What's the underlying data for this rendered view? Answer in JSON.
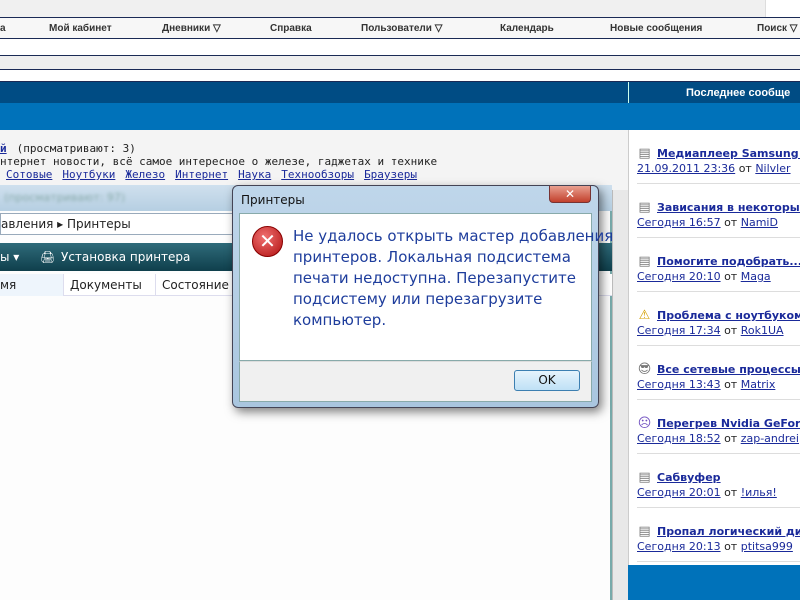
{
  "nav": {
    "items": [
      "а",
      "Мой кабинет",
      "Дневники ▽",
      "Справка",
      "Пользователи ▽",
      "Календарь",
      "Новые сообщения",
      "Поиск ▽"
    ]
  },
  "header": {
    "last_post_label": "Последнее сообще"
  },
  "forum": {
    "title_link": "й",
    "viewers": "(просматривают: 3)",
    "description": "нтернет новости, всё самое интересное о железе, гаджетах и технике",
    "sublinks": [
      "Сотовые",
      "Ноутбуки",
      "Железо",
      "Интернет",
      "Наука",
      "Технообзоры",
      "Браузеры"
    ]
  },
  "last_posts": [
    {
      "icon": "document-icon",
      "glyph": "▤",
      "title": "Медиаплеер Samsung YP",
      "date": "21.09.2011 23:36",
      "from": "от",
      "user": "Nilvler"
    },
    {
      "icon": "document-icon",
      "glyph": "▤",
      "title": "Зависания в некоторых и",
      "date": "Сегодня 16:57",
      "from": "от",
      "user": "NamiD"
    },
    {
      "icon": "document-icon",
      "glyph": "▤",
      "title": "Помогите подобрать...",
      "date": "Сегодня 20:10",
      "from": "от",
      "user": "Maga"
    },
    {
      "icon": "warning-icon",
      "glyph": "⚠",
      "title": "Проблема с ноутбуком",
      "date": "Сегодня 17:34",
      "from": "от",
      "user": "Rok1UA"
    },
    {
      "icon": "cool-smiley-icon",
      "glyph": "😎",
      "title": "Все сетевые процессы",
      "date": "Сегодня 13:43",
      "from": "от",
      "user": "Matrix"
    },
    {
      "icon": "sad-smiley-icon",
      "glyph": "☹",
      "title": "Перегрев Nvidia GeForce",
      "date": "Сегодня 18:52",
      "from": "от",
      "user": "zap-andrei"
    },
    {
      "icon": "document-icon",
      "glyph": "▤",
      "title": "Сабвуфер",
      "date": "Сегодня 20:01",
      "from": "от",
      "user": "!илья!"
    },
    {
      "icon": "document-icon",
      "glyph": "▤",
      "title": "Пропал логический диск",
      "date": "Сегодня 20:13",
      "from": "от",
      "user": "ptitsa999"
    }
  ],
  "printers_window": {
    "blurred_title": "(просматривают: 97)",
    "address": "авления ▸ Принтеры",
    "toolbar_left": "ы ▾",
    "toolbar_add": "Установка принтера",
    "columns": [
      "мя",
      "Документы",
      "Состояние"
    ]
  },
  "dialog": {
    "title": "Принтеры",
    "close": "✕",
    "message_lines": [
      "Не удалось открыть мастер добавления",
      "принтеров. Локальная подсистема",
      "печати недоступна.  Перезапустите",
      "подсистему или перезагрузите",
      "компьютер."
    ],
    "ok": "OK"
  },
  "colors": {
    "header": "#004c84",
    "accent": "#0072ba",
    "link": "#1a2a9a",
    "dialog_text": "#1e3d9c"
  }
}
